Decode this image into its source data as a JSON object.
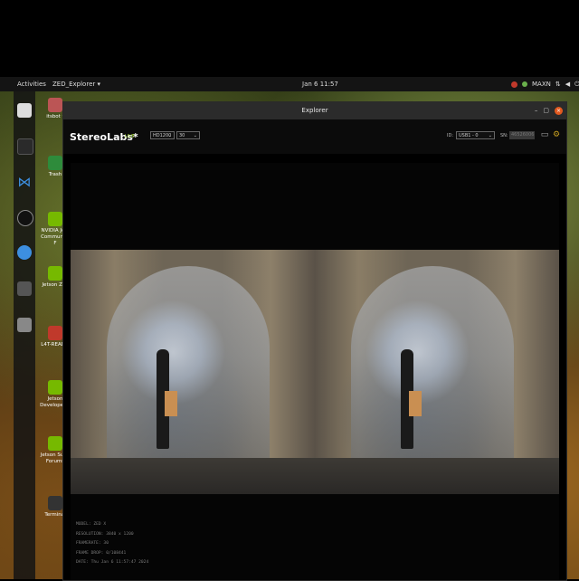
{
  "topbar": {
    "activities": "Activities",
    "app_menu": "ZED_Explorer ▾",
    "clock": "Jan 6  11:57",
    "maxn": "MAXN"
  },
  "desktop_icons": [
    {
      "label": "itsbot t"
    },
    {
      "label": "Trash"
    },
    {
      "label": "NVIDIA Jets Community F"
    },
    {
      "label": "Jetson Zoo"
    },
    {
      "label": "L4T-READM"
    },
    {
      "label": "Jetson Developer Z"
    },
    {
      "label": "Jetson Supp Forums"
    },
    {
      "label": "Terminal"
    }
  ],
  "window": {
    "title": "Explorer",
    "brand": "StereoLabs*",
    "live_badge": "LIVE",
    "resolution_select": "HD1200",
    "fps_select": "30",
    "id_label": "ID:",
    "device_select": "USB1 - 0",
    "sn_label": "SN:",
    "sn_value": "46526006",
    "info": {
      "model": "MODEL: ZED X",
      "resolution": "RESOLUTION: 3840 x 1200",
      "framerate": "FRAMERATE: 30",
      "frame_drop": "FRAME DROP: 0/108441",
      "date": "DATE: Thu Jan 6 11:57:47 2024"
    }
  },
  "colors": {
    "live": "#9ad12a",
    "close_button": "#e2591f"
  }
}
